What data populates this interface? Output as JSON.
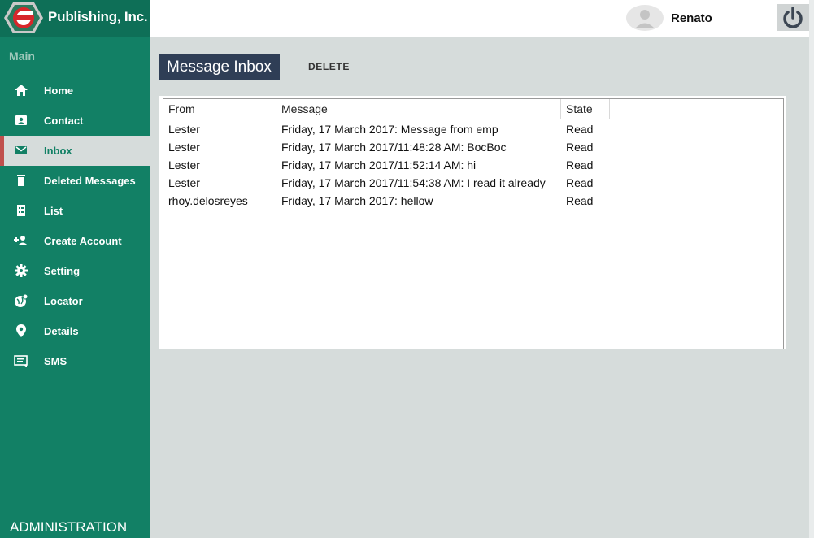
{
  "brand": {
    "name": "Publishing, Inc."
  },
  "sidebar": {
    "section_title": "Main",
    "items": [
      {
        "label": "Home",
        "icon": "home-icon"
      },
      {
        "label": "Contact",
        "icon": "contact-card-icon"
      },
      {
        "label": "Inbox",
        "icon": "mail-icon",
        "active": true
      },
      {
        "label": "Deleted Messages",
        "icon": "trash-icon"
      },
      {
        "label": "List",
        "icon": "list-icon"
      },
      {
        "label": "Create Account",
        "icon": "add-user-icon"
      },
      {
        "label": "Setting",
        "icon": "gear-icon"
      },
      {
        "label": "Locator",
        "icon": "globe-pin-icon"
      },
      {
        "label": "Details",
        "icon": "location-pin-icon"
      },
      {
        "label": "SMS",
        "icon": "sms-icon"
      }
    ],
    "footer": "ADMINISTRATION"
  },
  "header": {
    "username": "Renato"
  },
  "main": {
    "title": "Message Inbox",
    "delete_label": "DELETE",
    "columns": [
      "From",
      "Message",
      "State"
    ],
    "rows": [
      {
        "from": "Lester",
        "message": "Friday, 17 March 2017:  Message from emp",
        "state": "Read"
      },
      {
        "from": "Lester",
        "message": "Friday, 17 March 2017/11:48:28 AM: BocBoc",
        "state": "Read"
      },
      {
        "from": "Lester",
        "message": "Friday, 17 March 2017/11:52:14 AM: hi",
        "state": "Read"
      },
      {
        "from": "Lester",
        "message": "Friday, 17 March 2017/11:54:38 AM: I read it already",
        "state": "Read"
      },
      {
        "from": "rhoy.delosreyes",
        "message": "Friday, 17 March 2017:  hellow",
        "state": "Read"
      }
    ]
  },
  "colors": {
    "sidebar": "#128065",
    "title_badge": "#2f3e56",
    "active_marker": "#c0504d",
    "background": "#d6dcdb"
  }
}
